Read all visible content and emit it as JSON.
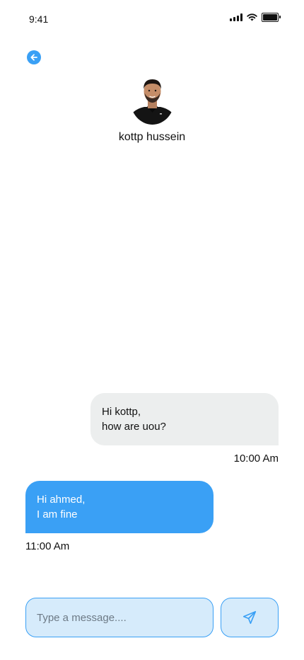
{
  "status_bar": {
    "time": "9:41",
    "icons": [
      "signal-icon",
      "wifi-icon",
      "battery-icon"
    ]
  },
  "header": {
    "back_icon": "arrow-left-icon",
    "contact_name": "kottp hussein",
    "avatar": "contact-avatar"
  },
  "messages": [
    {
      "direction": "received",
      "text": "Hi kottp,\nhow are uou?",
      "time": "10:00 Am"
    },
    {
      "direction": "sent",
      "text": "Hi ahmed,\nI am fine",
      "time": "11:00 Am"
    }
  ],
  "composer": {
    "placeholder": "Type a message....",
    "value": "",
    "send_icon": "send-icon"
  },
  "colors": {
    "accent": "#3aa0f5",
    "input_bg": "#d6ebfb",
    "received_bubble": "#eceeee",
    "text": "#111111"
  }
}
